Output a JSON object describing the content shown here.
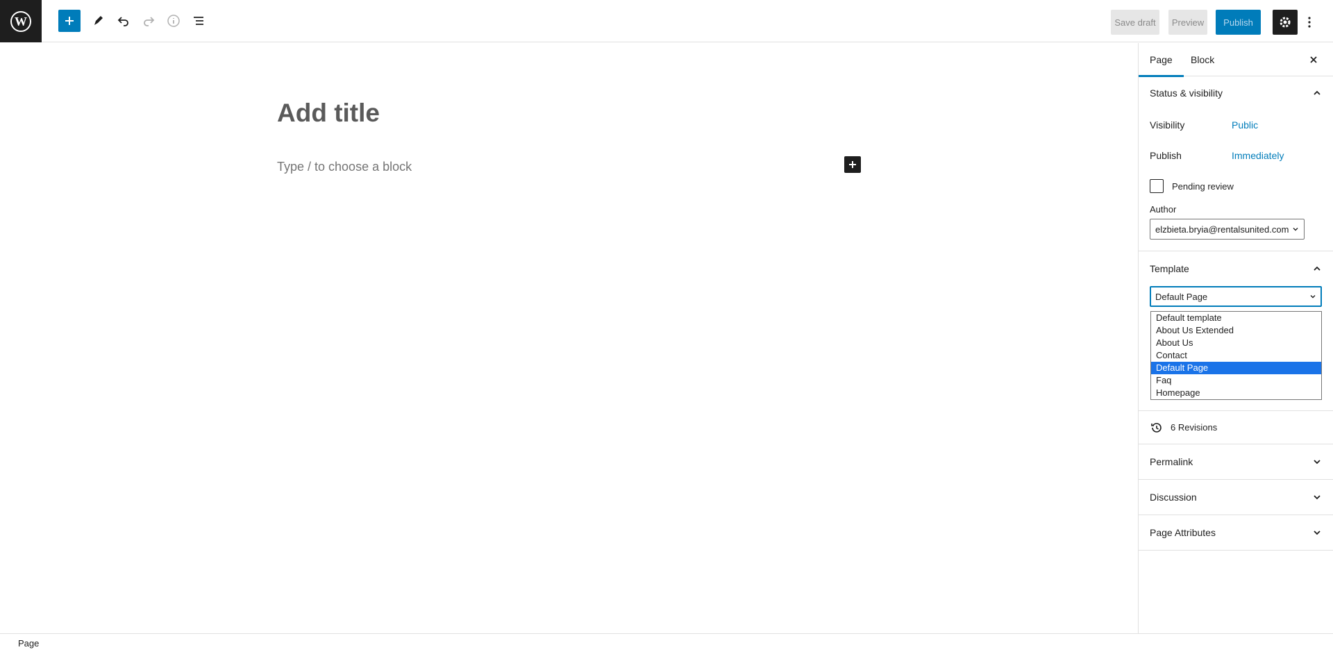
{
  "toolbar": {
    "save_draft": "Save draft",
    "preview": "Preview",
    "publish": "Publish"
  },
  "editor": {
    "title_placeholder": "Add title",
    "block_placeholder": "Type / to choose a block"
  },
  "sidebar": {
    "tabs": [
      "Page",
      "Block"
    ],
    "status_visibility": {
      "heading": "Status & visibility",
      "visibility_label": "Visibility",
      "visibility_value": "Public",
      "publish_label": "Publish",
      "publish_value": "Immediately",
      "pending_review_label": "Pending review",
      "author_label": "Author",
      "author_value": "elzbieta.bryia@rentalsunited.com"
    },
    "template": {
      "heading": "Template",
      "selected": "Default Page",
      "options": [
        "Default template",
        "About Us Extended",
        "About Us",
        "Contact",
        "Default Page",
        "Faq",
        "Homepage"
      ]
    },
    "revisions": "6 Revisions",
    "permalink": "Permalink",
    "discussion": "Discussion",
    "page_attributes": "Page Attributes"
  },
  "footer": {
    "breadcrumb": "Page"
  },
  "colors": {
    "accent": "#007cba",
    "dark": "#1e1e1e",
    "selected_option": "#1a73e8"
  }
}
